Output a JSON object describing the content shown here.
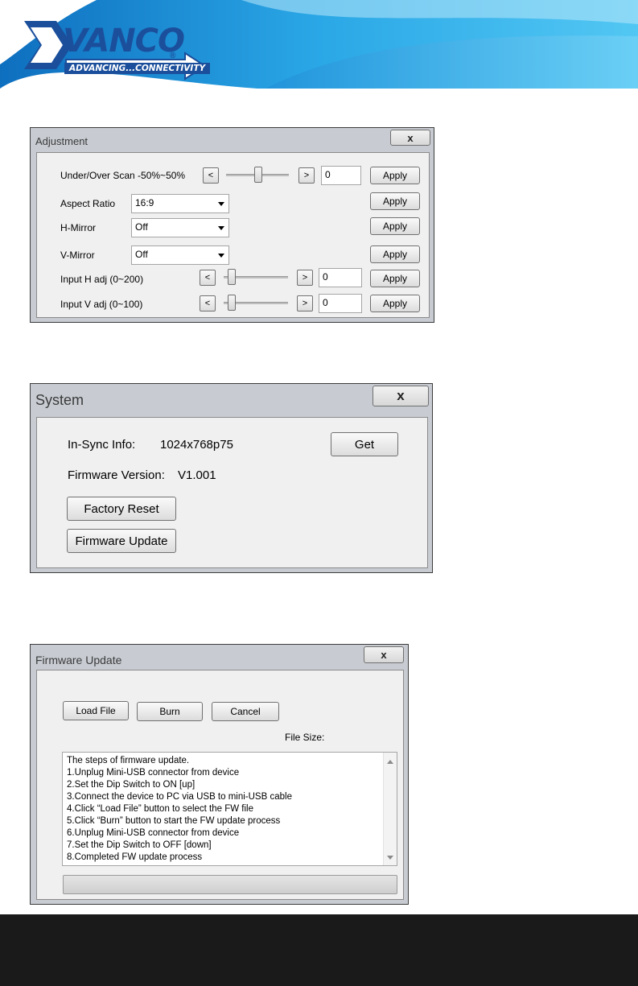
{
  "branding": {
    "name": "VANCO",
    "registered": "®",
    "tagline": "ADVANCING...CONNECTIVITY",
    "colors": {
      "brand_blue": "#1b4f9c",
      "banner_cyan": "#29b6ef",
      "banner_dark": "#0e6fbf"
    }
  },
  "adjustment": {
    "title": "Adjustment",
    "close": "x",
    "rows": [
      {
        "label": "Under/Over Scan -50%~50%",
        "dec": "<",
        "inc": ">",
        "value": "0",
        "apply": "Apply"
      },
      {
        "label": "Aspect Ratio",
        "selected": "16:9",
        "apply": "Apply"
      },
      {
        "label": "H-Mirror",
        "selected": "Off",
        "apply": "Apply"
      },
      {
        "label": "V-Mirror",
        "selected": "Off",
        "apply": "Apply"
      },
      {
        "label": "Input H adj (0~200)",
        "dec": "<",
        "inc": ">",
        "value": "0",
        "apply": "Apply"
      },
      {
        "label": "Input V adj (0~100)",
        "dec": "<",
        "inc": ">",
        "value": "0",
        "apply": "Apply"
      }
    ]
  },
  "system": {
    "title": "System",
    "close": "x",
    "insync_label": "In-Sync Info:",
    "insync_value": "1024x768p75",
    "get": "Get",
    "fw_label": "Firmware Version:",
    "fw_value": "V1.001",
    "factory_reset": "Factory Reset",
    "firmware_update": "Firmware Update"
  },
  "firmware": {
    "title": "Firmware Update",
    "close": "x",
    "load_file": "Load File",
    "burn": "Burn",
    "cancel": "Cancel",
    "file_size": "File Size:",
    "steps": [
      "The steps of firmware update.",
      " 1.Unplug Mini-USB connector from device",
      " 2.Set the Dip Switch to ON [up]",
      " 3.Connect the device to PC via USB to mini-USB cable",
      " 4.Click “Load File” button to select the FW file",
      " 5.Click “Burn” button to start the FW update process",
      " 6.Unplug Mini-USB connector from device",
      " 7.Set the Dip Switch to OFF [down]",
      " 8.Completed FW update process"
    ]
  }
}
